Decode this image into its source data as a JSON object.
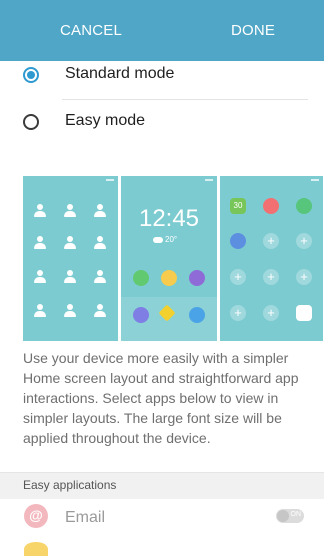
{
  "header": {
    "cancel_label": "CANCEL",
    "done_label": "DONE",
    "color": "#4fa6c7"
  },
  "modes": [
    {
      "label": "Standard mode",
      "selected": true
    },
    {
      "label": "Easy mode",
      "selected": false
    }
  ],
  "preview": {
    "clock": "12:45",
    "weather": "20°",
    "calendar_day": "30"
  },
  "description": "Use your device more easily with a simpler Home screen layout and straightforward app interactions. Select apps below to view in simpler layouts. The large font size will be applied throughout the device.",
  "easy_applications": {
    "section_label": "Easy applications",
    "apps": [
      {
        "name": "Email",
        "toggle_label": "ON",
        "icon": "email-icon"
      }
    ]
  },
  "colors": {
    "accent": "#2f9ad0",
    "preview_bg": "#7ccbd0"
  }
}
